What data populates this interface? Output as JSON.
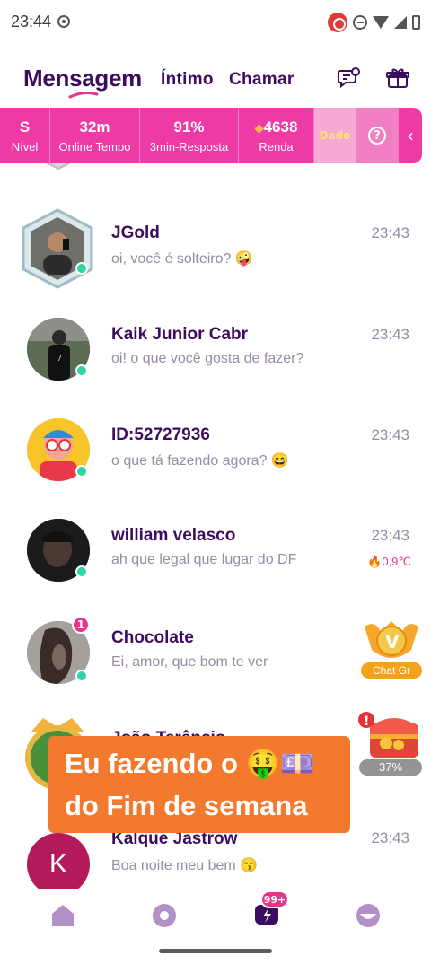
{
  "status_bar": {
    "time": "23:44"
  },
  "header": {
    "tabs": [
      {
        "label": "Mensagem",
        "active": true
      },
      {
        "label": "Íntimo",
        "active": false
      },
      {
        "label": "Chamar",
        "active": false
      }
    ],
    "icons": [
      "chat-settings-icon",
      "gift-box-icon"
    ]
  },
  "stats": {
    "items": [
      {
        "value": "S",
        "label": "Nível"
      },
      {
        "value": "32m",
        "label": "Online Tempo"
      },
      {
        "value": "91%",
        "label": "3min-Resposta"
      },
      {
        "value": "4638",
        "label": "Renda",
        "icon": "diamond-icon"
      }
    ],
    "dado_label": "Dado",
    "help_label": "?",
    "arrow": "‹"
  },
  "conversations": [
    {
      "name": "JGold",
      "message": "oi, você é solteiro? 🤪",
      "time": "23:43",
      "online": true
    },
    {
      "name": "Kaik Junior Cabr",
      "message": "oi! o que você gosta de fazer?",
      "time": "23:43",
      "online": true
    },
    {
      "name": "ID:52727936",
      "message": "o que tá fazendo agora? 😄",
      "time": "23:43",
      "online": true
    },
    {
      "name": "william velasco",
      "message": "ah que legal que lugar do DF",
      "time": "23:43",
      "temperature": "0,9℃",
      "online": true
    },
    {
      "name": "Chocolate",
      "message": "Ei, amor, que bom te ver",
      "unread": "1",
      "online": true
    },
    {
      "name": "João Terêncio",
      "message": "",
      "time": ""
    },
    {
      "name": "Kalque Jastrow",
      "message": "Boa noite meu bem 😙",
      "time": "23:43",
      "avatar_letter": "K"
    }
  ],
  "widgets": {
    "chat_gr_label": "Chat Gr",
    "chest_progress": "37%",
    "chest_alert": "!"
  },
  "caption": {
    "line1": "Eu fazendo o 🤑💷",
    "line2": "do Fim de semana"
  },
  "nav": {
    "badge": "99+",
    "items": [
      "home-icon",
      "discover-icon",
      "messages-icon",
      "profile-icon"
    ]
  },
  "colors": {
    "accent": "#ee3aa5",
    "title": "#3c0c5e",
    "online": "#2fd5a4",
    "caption_bg": "#f2792d"
  }
}
